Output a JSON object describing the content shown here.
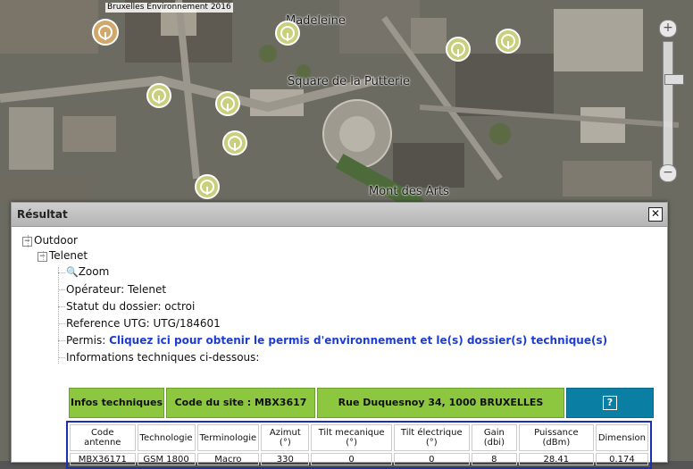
{
  "map": {
    "copyright": "Bruxelles Environnement 2016",
    "places": [
      {
        "name": "Madeleine"
      },
      {
        "name": "Square de la Putterie"
      },
      {
        "name": "Mont des Arts"
      }
    ]
  },
  "zoom": {
    "plus": "+",
    "minus": "−"
  },
  "dialog": {
    "title": "Résultat",
    "close": "✕",
    "tree": {
      "outdoor": "Outdoor",
      "telenet": "Telenet",
      "zoom": "Zoom",
      "operateur": "Opérateur: Telenet",
      "statut": "Statut du dossier: octroi",
      "reference": "Reference UTG: UTG/184601",
      "permis_label": "Permis:",
      "permis_link": "Cliquez ici pour obtenir le permis d'environnement et le(s) dossier(s) technique(s)",
      "infos": "Informations techniques ci-dessous:"
    },
    "info_bar": {
      "infos": "Infos techniques",
      "code_site": "Code du site : MBX3617",
      "address": "Rue Duquesnoy 34, 1000 BRUXELLES",
      "help": "?"
    },
    "table": {
      "headers": [
        "Code antenne",
        "Technologie",
        "Terminologie",
        "Azimut (°)",
        "Tilt mecanique (°)",
        "Tilt électrique (°)",
        "Gain (dbi)",
        "Puissance (dBm)",
        "Dimension"
      ],
      "rows": [
        [
          "MBX36171",
          "GSM 1800",
          "Macro",
          "330",
          "0",
          "0",
          "8",
          "28.41",
          "0.174"
        ]
      ]
    }
  },
  "colors": {
    "green_cell": "#8dc63f",
    "blue_cell": "#0a7fa3",
    "link": "#1c3cd6",
    "table_border": "#1b2fb0"
  }
}
